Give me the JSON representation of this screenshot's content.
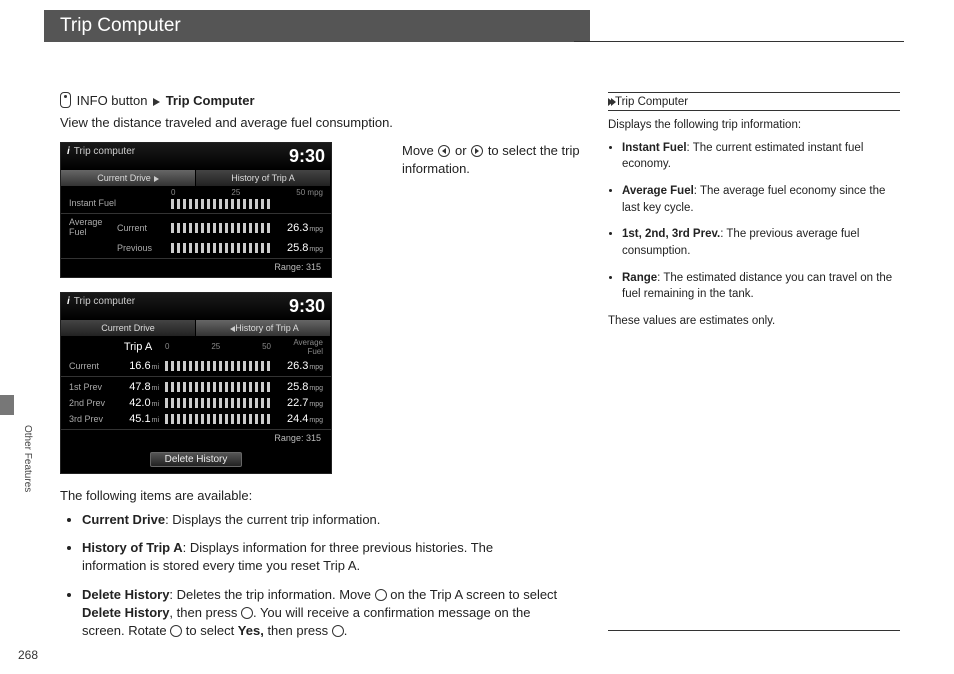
{
  "title": "Trip Computer",
  "page_number": "268",
  "side_section": "Other Features",
  "breadcrumb": {
    "info_button": "INFO button",
    "target": "Trip Computer"
  },
  "intro": "View the distance traveled and average fuel consumption.",
  "nav_instruction": {
    "pre": "Move ",
    "mid": " or ",
    "post": " to select the trip information."
  },
  "shot1": {
    "title": "Trip computer",
    "time": "9:30",
    "tab_a": "Current Drive",
    "tab_a_icon": "⟲",
    "tab_b": "History of Trip A",
    "scale": [
      "0",
      "25",
      "50 mpg"
    ],
    "row_instant": "Instant Fuel",
    "row_avg": "Average Fuel",
    "lbl_current": "Current",
    "lbl_prev": "Previous",
    "val_current": "26.3",
    "unit": "mpg",
    "val_prev": "25.8",
    "range_lbl": "Range:",
    "range_val": "315"
  },
  "shot2": {
    "title": "Trip computer",
    "time": "9:30",
    "tab_a": "Current Drive",
    "tab_b": "History of Trip A",
    "cols": {
      "trip": "Trip A",
      "scale": [
        "0",
        "25",
        "50"
      ],
      "avg": "Average Fuel"
    },
    "rows": [
      {
        "label": "Current",
        "trip": "16.6",
        "trip_u": "mi",
        "val": "26.3",
        "u": "mpg"
      },
      {
        "label": "1st Prev",
        "trip": "47.8",
        "trip_u": "mi",
        "val": "25.8",
        "u": "mpg"
      },
      {
        "label": "2nd Prev",
        "trip": "42.0",
        "trip_u": "mi",
        "val": "22.7",
        "u": "mpg"
      },
      {
        "label": "3rd Prev",
        "trip": "45.1",
        "trip_u": "mi",
        "val": "24.4",
        "u": "mpg"
      }
    ],
    "range_lbl": "Range:",
    "range_val": "315",
    "delete_btn": "Delete History"
  },
  "items_intro": "The following items are available:",
  "items": [
    {
      "name": "Current Drive",
      "desc": ": Displays the current trip information."
    },
    {
      "name": "History of Trip A",
      "desc": ": Displays information for three previous histories. The information is stored every time you reset Trip A."
    },
    {
      "name": "Delete History",
      "desc_a": ": Deletes the trip information. Move ",
      "desc_b": " on the Trip A screen to select ",
      "desc_bold": "Delete History",
      "desc_c": ", then press ",
      "desc_d": ". You will receive a confirmation message on the screen. Rotate ",
      "desc_e": " to select ",
      "yes": "Yes,",
      "desc_f": " then press ",
      "desc_g": "."
    }
  ],
  "right": {
    "heading": "Trip Computer",
    "intro": "Displays the following trip information:",
    "bullets": [
      {
        "b": "Instant Fuel",
        "t": ": The current estimated instant fuel economy."
      },
      {
        "b": "Average Fuel",
        "t": ": The average fuel economy since the last key cycle."
      },
      {
        "b": "1st, 2nd, 3rd Prev.",
        "t": ": The previous average fuel consumption."
      },
      {
        "b": "Range",
        "t": ": The estimated distance you can travel on the fuel remaining in the tank."
      }
    ],
    "note": "These values are estimates only."
  }
}
